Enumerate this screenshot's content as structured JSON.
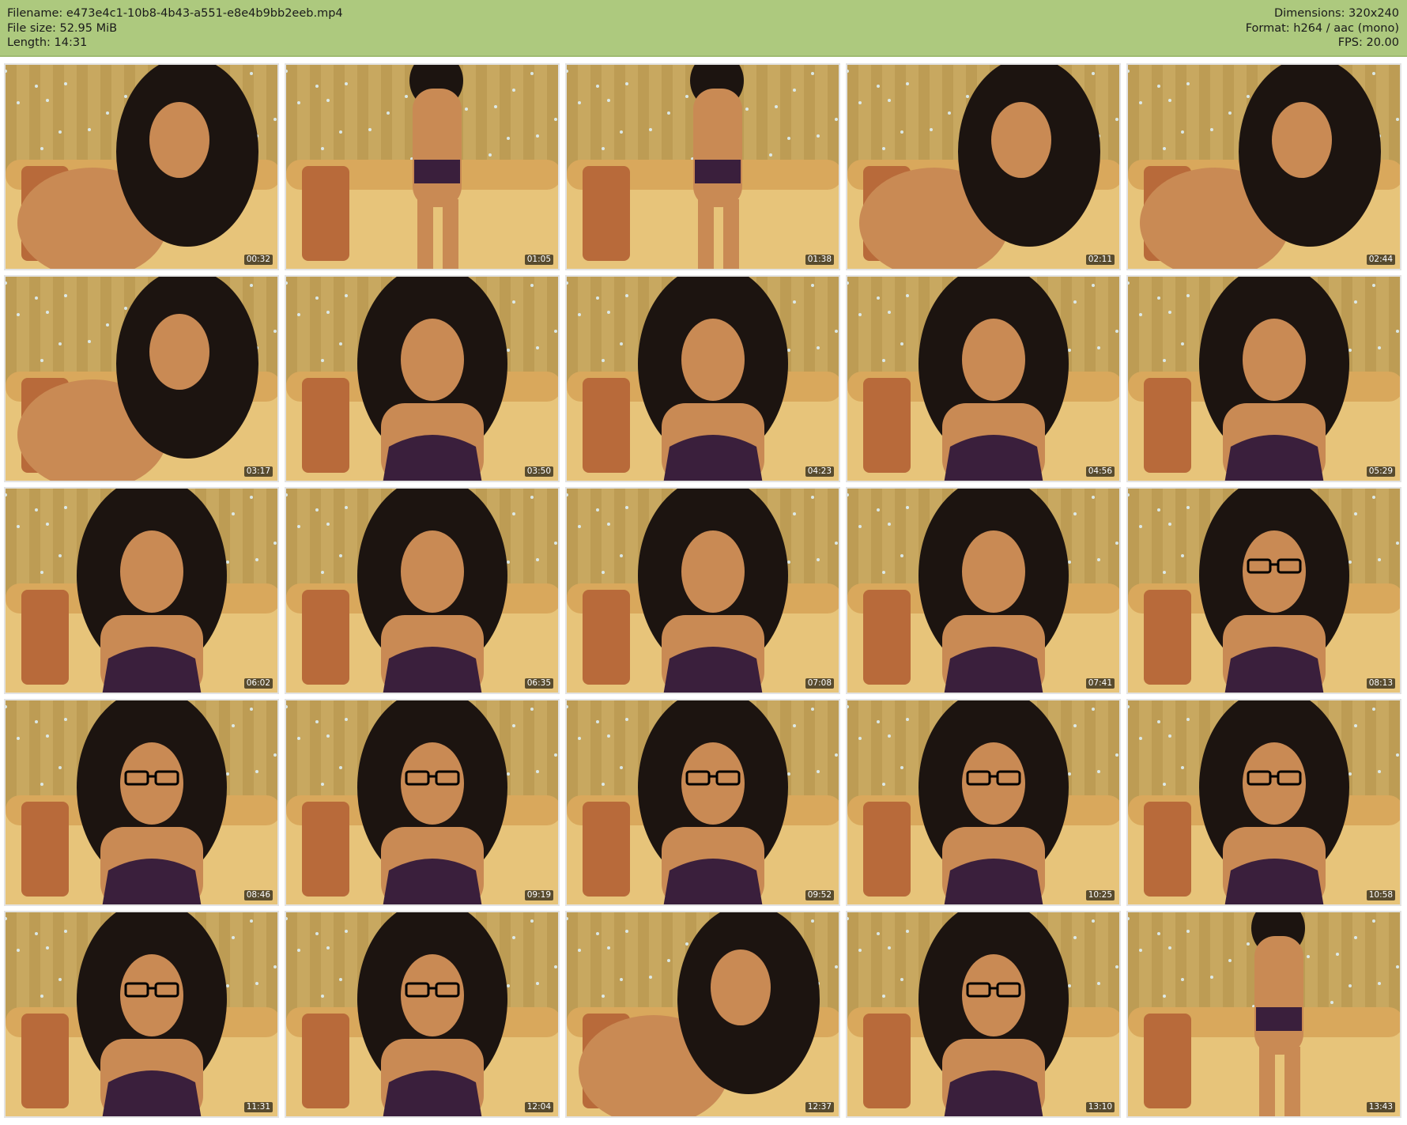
{
  "header": {
    "left": [
      "Filename: e473e4c1-10b8-4b43-a551-e8e4b9bb2eeb.mp4",
      "File size: 52.95 MiB",
      "Length: 14:31"
    ],
    "right": [
      "Dimensions: 320x240",
      "Format: h264 / aac (mono)",
      "FPS: 20.00"
    ]
  },
  "thumbnails": [
    {
      "timestamp": "00:32",
      "scene": "lean"
    },
    {
      "timestamp": "01:05",
      "scene": "stand"
    },
    {
      "timestamp": "01:38",
      "scene": "stand"
    },
    {
      "timestamp": "02:11",
      "scene": "lean"
    },
    {
      "timestamp": "02:44",
      "scene": "lean"
    },
    {
      "timestamp": "03:17",
      "scene": "lean"
    },
    {
      "timestamp": "03:50",
      "scene": "sit"
    },
    {
      "timestamp": "04:23",
      "scene": "sit"
    },
    {
      "timestamp": "04:56",
      "scene": "sit"
    },
    {
      "timestamp": "05:29",
      "scene": "sit"
    },
    {
      "timestamp": "06:02",
      "scene": "sit"
    },
    {
      "timestamp": "06:35",
      "scene": "sit"
    },
    {
      "timestamp": "07:08",
      "scene": "sit"
    },
    {
      "timestamp": "07:41",
      "scene": "sit"
    },
    {
      "timestamp": "08:13",
      "scene": "sit-glasses"
    },
    {
      "timestamp": "08:46",
      "scene": "sit-glasses"
    },
    {
      "timestamp": "09:19",
      "scene": "sit-glasses"
    },
    {
      "timestamp": "09:52",
      "scene": "sit-glasses"
    },
    {
      "timestamp": "10:25",
      "scene": "sit-glasses"
    },
    {
      "timestamp": "10:58",
      "scene": "sit-glasses"
    },
    {
      "timestamp": "11:31",
      "scene": "sit-glasses"
    },
    {
      "timestamp": "12:04",
      "scene": "sit-glasses"
    },
    {
      "timestamp": "12:37",
      "scene": "lean"
    },
    {
      "timestamp": "13:10",
      "scene": "sit-glasses"
    },
    {
      "timestamp": "13:43",
      "scene": "stand"
    }
  ],
  "colors": {
    "header_bg": "#adc97e",
    "timestamp_bg": "#000000",
    "curtain": "#c8a860",
    "sofa": "#e7c47a",
    "hair": "#1c1410",
    "skin": "#c98a54",
    "lingerie": "#3a1f3c"
  }
}
